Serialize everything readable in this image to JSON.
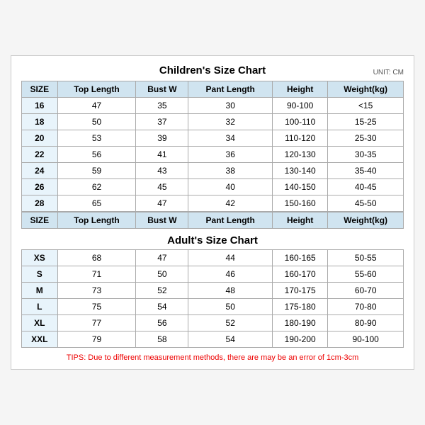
{
  "chart": {
    "title": "Children's Size Chart",
    "adult_title": "Adult's Size Chart",
    "unit": "UNIT: CM",
    "headers": [
      "SIZE",
      "Top Length",
      "Bust W",
      "Pant Length",
      "Height",
      "Weight(kg)"
    ],
    "children_rows": [
      [
        "16",
        "47",
        "35",
        "30",
        "90-100",
        "<15"
      ],
      [
        "18",
        "50",
        "37",
        "32",
        "100-110",
        "15-25"
      ],
      [
        "20",
        "53",
        "39",
        "34",
        "110-120",
        "25-30"
      ],
      [
        "22",
        "56",
        "41",
        "36",
        "120-130",
        "30-35"
      ],
      [
        "24",
        "59",
        "43",
        "38",
        "130-140",
        "35-40"
      ],
      [
        "26",
        "62",
        "45",
        "40",
        "140-150",
        "40-45"
      ],
      [
        "28",
        "65",
        "47",
        "42",
        "150-160",
        "45-50"
      ]
    ],
    "adult_rows": [
      [
        "XS",
        "68",
        "47",
        "44",
        "160-165",
        "50-55"
      ],
      [
        "S",
        "71",
        "50",
        "46",
        "160-170",
        "55-60"
      ],
      [
        "M",
        "73",
        "52",
        "48",
        "170-175",
        "60-70"
      ],
      [
        "L",
        "75",
        "54",
        "50",
        "175-180",
        "70-80"
      ],
      [
        "XL",
        "77",
        "56",
        "52",
        "180-190",
        "80-90"
      ],
      [
        "XXL",
        "79",
        "58",
        "54",
        "190-200",
        "90-100"
      ]
    ],
    "tips": "TIPS: Due to different measurement methods, there are may be an error of 1cm-3cm"
  }
}
